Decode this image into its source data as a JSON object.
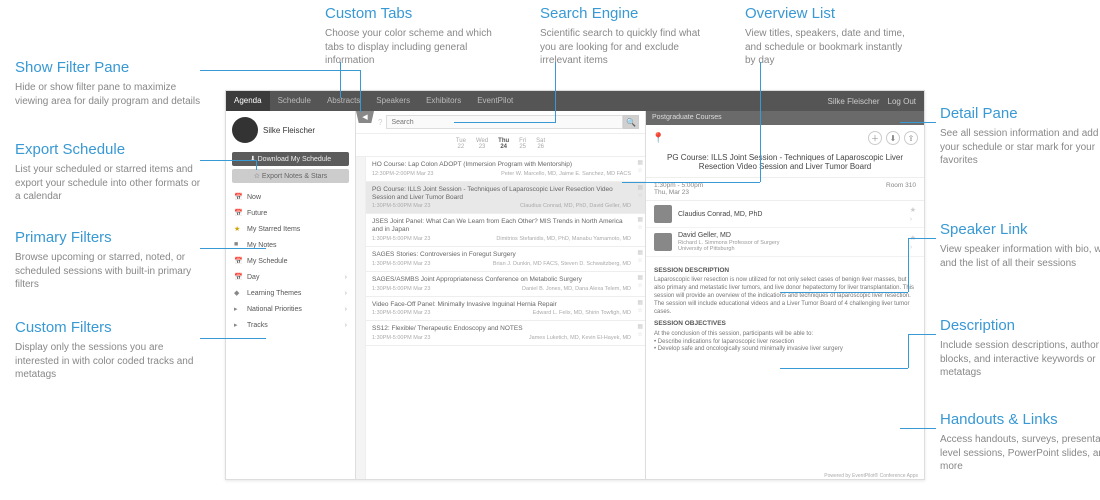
{
  "annotations": {
    "show_filter": {
      "title": "Show Filter Pane",
      "body": "Hide or show filter pane to maximize viewing area for daily program and details"
    },
    "export": {
      "title": "Export Schedule",
      "body": "List your scheduled or starred items and export your schedule into other formats or a calendar"
    },
    "primary": {
      "title": "Primary Filters",
      "body": "Browse upcoming or starred, noted, or scheduled sessions with built-in primary filters"
    },
    "custom_filters": {
      "title": "Custom Filters",
      "body": "Display only the sessions you are interested in with color coded tracks and metatags"
    },
    "custom_tabs": {
      "title": "Custom Tabs",
      "body": "Choose your color scheme and which tabs to display including general information"
    },
    "search": {
      "title": "Search Engine",
      "body": "Scientific search to quickly find what you are looking for and exclude irrelevant items"
    },
    "overview": {
      "title": "Overview List",
      "body": "View titles, speakers, date and time, and schedule or bookmark instantly by day"
    },
    "detail": {
      "title": "Detail Pane",
      "body": "See all session information and add to your schedule or star mark for your favorites"
    },
    "speaker": {
      "title": "Speaker Link",
      "body": "View speaker information with bio, website and the list of all their sessions"
    },
    "description": {
      "title": "Description",
      "body": "Include session descriptions, author blocks, and interactive keywords or metatags"
    },
    "handouts": {
      "title": "Handouts & Links",
      "body": "Access handouts, surveys, presentation level sessions, PowerPoint slides, and more"
    }
  },
  "tabs": [
    "Agenda",
    "Schedule",
    "Abstracts",
    "Speakers",
    "Exhibitors",
    "EventPilot"
  ],
  "user": {
    "name": "Silke Fleischer",
    "logout": "Log Out"
  },
  "profile_name": "Silke Fleischer",
  "buttons": {
    "download": "⬇ Download My Schedule",
    "export": "☆ Export Notes & Stars"
  },
  "filters": [
    {
      "icon": "📅",
      "label": "Now"
    },
    {
      "icon": "📅",
      "label": "Future"
    },
    {
      "icon": "★",
      "label": "My Starred Items",
      "star": true
    },
    {
      "icon": "■",
      "label": "My Notes"
    },
    {
      "icon": "📅",
      "label": "My Schedule"
    },
    {
      "icon": "📅",
      "label": "Day",
      "chev": true
    },
    {
      "icon": "◆",
      "label": "Learning Themes",
      "chev": true
    },
    {
      "icon": "▸",
      "label": "National Priorities",
      "chev": true
    },
    {
      "icon": "▸",
      "label": "Tracks",
      "chev": true
    }
  ],
  "search_placeholder": "Search",
  "days": [
    {
      "d": "Tue",
      "n": "22"
    },
    {
      "d": "Wed",
      "n": "23"
    },
    {
      "d": "Thu",
      "n": "24"
    },
    {
      "d": "Fri",
      "n": "25"
    },
    {
      "d": "Sat",
      "n": "26"
    }
  ],
  "active_day": 2,
  "sessions": [
    {
      "title": "HO Course: Lap Colon ADOPT (Immersion Program with Mentorship)",
      "time": "12:30PM-2:00PM Mar 23",
      "spk": "Peter W. Marcello, MD, Jaime E. Sanchez, MD FACS"
    },
    {
      "title": "PG Course: ILLS Joint Session - Techniques of Laparoscopic Liver Resection Video Session and Liver Tumor Board",
      "time": "1:30PM-5:00PM Mar 23",
      "spk": "Claudius Conrad, MD, PhD, David Geller, MD",
      "sel": true
    },
    {
      "title": "JSES Joint Panel: What Can We Learn from Each Other? MIS Trends in North America and in Japan",
      "time": "1:30PM-5:00PM Mar 23",
      "spk": "Dimitrios Stefanidis, MD, PhD, Manabu Yamamoto, MD"
    },
    {
      "title": "SAGES Stories: Controversies in Foregut Surgery",
      "time": "1:30PM-5:00PM Mar 23",
      "spk": "Brian J. Dunkin, MD FACS, Steven D. Schwaitzberg, MD"
    },
    {
      "title": "SAGES/ASMBS Joint Appropriateness Conference on Metabolic Surgery",
      "time": "1:30PM-5:00PM Mar 23",
      "spk": "Daniel B. Jones, MD, Dana Alexa Telem, MD"
    },
    {
      "title": "Video Face-Off Panel: Minimally Invasive Inguinal Hernia Repair",
      "time": "1:30PM-5:00PM Mar 23",
      "spk": "Edward L. Felix, MD, Shirin Towfigh, MD"
    },
    {
      "title": "SS12: Flexible/ Therapeutic Endoscopy and NOTES",
      "time": "1:30PM-5:00PM Mar 23",
      "spk": "James Luketich, MD, Kevin El-Hayek, MD"
    }
  ],
  "detail": {
    "crumb": "Postgraduate Courses",
    "title": "PG Course: ILLS Joint Session - Techniques of Laparoscopic Liver Resection Video Session and Liver Tumor Board",
    "time": "1:30pm - 5:00pm",
    "date": "Thu, Mar 23",
    "room": "Room 310",
    "speakers": [
      {
        "name": "Claudius Conrad, MD, PhD",
        "aff": ""
      },
      {
        "name": "David Geller, MD",
        "aff": "Richard L. Simmons Professor of Surgery\nUniversity of Pittsburgh"
      }
    ],
    "desc_head": "SESSION DESCRIPTION",
    "desc": "Laparoscopic liver resection is now utilized for not only select cases of benign liver masses, but also primary and metastatic liver tumors, and live donor hepatectomy for liver transplantation. This session will provide an overview of the indications and techniques of laparoscopic liver resection. The session will include educational videos and a Liver Tumor Board of 4 challenging liver tumor cases.",
    "obj_head": "SESSION OBJECTIVES",
    "obj_intro": "At the conclusion of this session, participants will be able to:",
    "obj1": "• Describe indications for laparoscopic liver resection",
    "obj2": "• Develop safe and oncologically sound minimally invasive liver surgery"
  },
  "footer": "Powered by EventPilot® Conference Apps"
}
